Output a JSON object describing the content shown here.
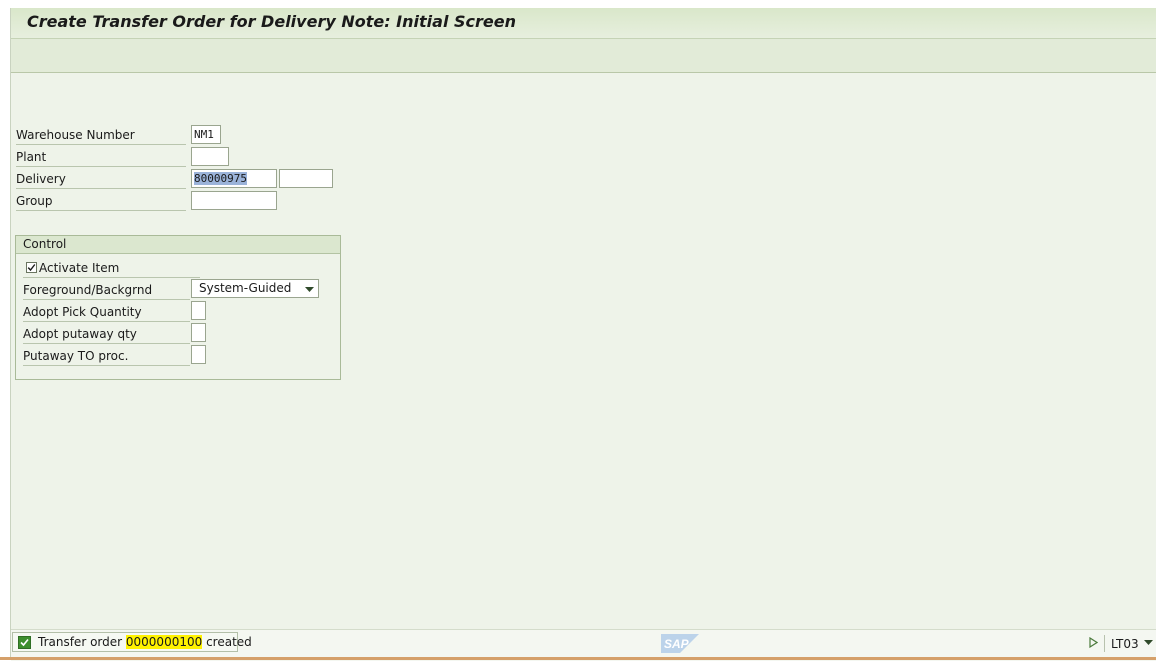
{
  "window": {
    "title": "Create Transfer Order for Delivery Note: Initial Screen"
  },
  "form": {
    "warehouse_number": {
      "label": "Warehouse Number",
      "value": "NM1"
    },
    "plant": {
      "label": "Plant",
      "value": ""
    },
    "delivery": {
      "label": "Delivery",
      "value": "80000975",
      "value2": ""
    },
    "group": {
      "label": "Group",
      "value": ""
    }
  },
  "control": {
    "title": "Control",
    "activate_item": {
      "label": "Activate Item",
      "checked": true
    },
    "foreground": {
      "label": "Foreground/Backgrnd",
      "value": "System-Guided"
    },
    "adopt_pick": {
      "label": "Adopt Pick Quantity",
      "value": ""
    },
    "adopt_putaway": {
      "label": "Adopt putaway qty",
      "value": ""
    },
    "putaway_to": {
      "label": "Putaway TO proc.",
      "value": ""
    }
  },
  "status": {
    "msg_before": "Transfer order ",
    "msg_number": "0000000100",
    "msg_after": " created",
    "icon": "success-check-icon",
    "icon_color": "#3d8f2e",
    "highlight_color": "#fff200",
    "logo": "SAP",
    "transaction": "LT03"
  }
}
